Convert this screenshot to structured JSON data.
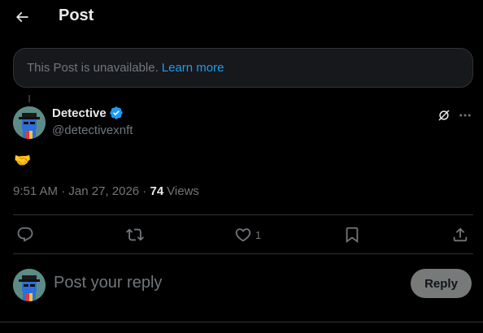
{
  "header": {
    "title": "Post",
    "back_icon": "arrow-left-icon"
  },
  "banner": {
    "text": "This Post is unavailable.",
    "link_label": "Learn more",
    "link_color": "#1d9bf0"
  },
  "post": {
    "author_name": "Detective",
    "author_handle": "@detectivexnft",
    "verified": true,
    "text": "🤝",
    "time": "9:51 AM",
    "date": "Jan 27, 2026",
    "views_count": "74",
    "views_label": "Views"
  },
  "actions": {
    "reply_count": "",
    "repost_count": "",
    "like_count": "1",
    "icons": [
      "reply-icon",
      "repost-icon",
      "like-icon",
      "bookmark-icon",
      "share-icon"
    ]
  },
  "composer": {
    "placeholder": "Post your reply",
    "button_label": "Reply"
  },
  "colors": {
    "background": "#000000",
    "muted": "#71767b",
    "accent": "#1d9bf0",
    "border": "#2f3336"
  }
}
